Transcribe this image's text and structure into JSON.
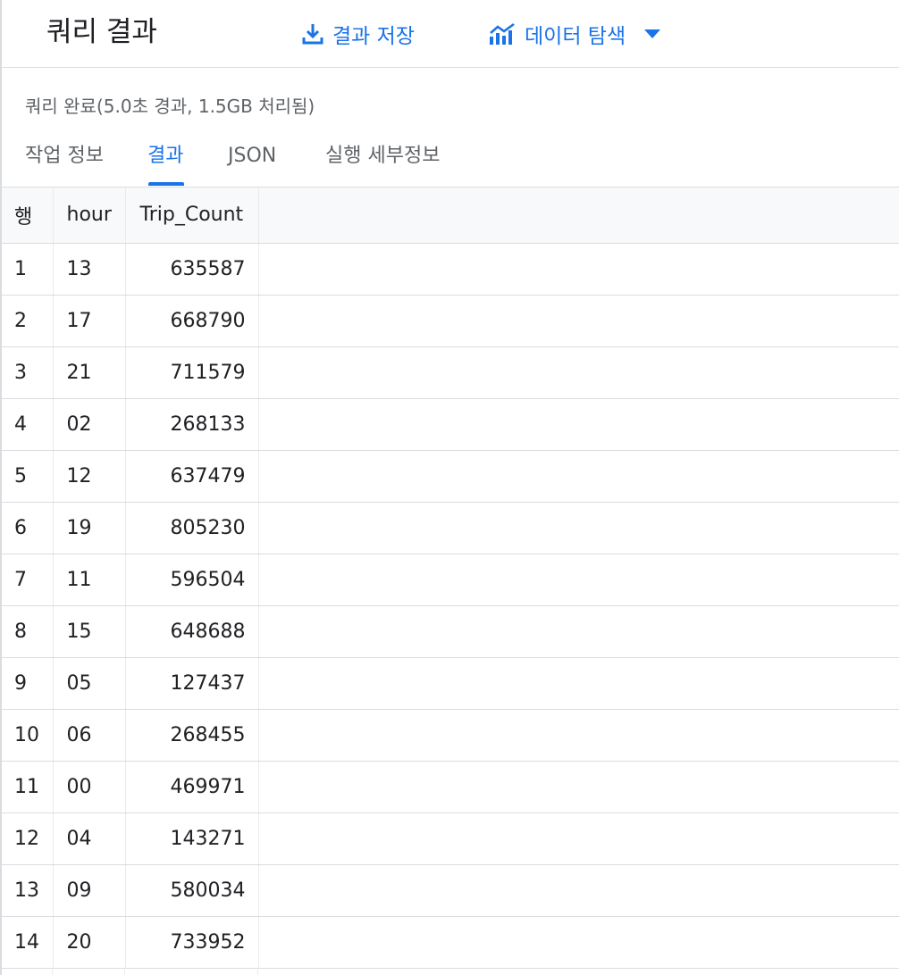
{
  "header": {
    "title": "쿼리 결과",
    "save_label": "결과 저장",
    "explore_label": "데이터 탐색",
    "accent_color": "#1a73e8",
    "icons": {
      "save": "download-icon",
      "explore": "chart-icon",
      "caret": "caret-down-icon"
    }
  },
  "status": "쿼리 완료(5.0초 경과, 1.5GB 처리됨)",
  "tabs": [
    {
      "label": "작업 정보",
      "active": false
    },
    {
      "label": "결과",
      "active": true
    },
    {
      "label": "JSON",
      "active": false
    },
    {
      "label": "실행 세부정보",
      "active": false
    }
  ],
  "table": {
    "columns": [
      "행",
      "hour",
      "Trip_Count"
    ],
    "rows": [
      [
        "1",
        "13",
        "635587"
      ],
      [
        "2",
        "17",
        "668790"
      ],
      [
        "3",
        "21",
        "711579"
      ],
      [
        "4",
        "02",
        "268133"
      ],
      [
        "5",
        "12",
        "637479"
      ],
      [
        "6",
        "19",
        "805230"
      ],
      [
        "7",
        "11",
        "596504"
      ],
      [
        "8",
        "15",
        "648688"
      ],
      [
        "9",
        "05",
        "127437"
      ],
      [
        "10",
        "06",
        "268455"
      ],
      [
        "11",
        "00",
        "469971"
      ],
      [
        "12",
        "04",
        "143271"
      ],
      [
        "13",
        "09",
        "580034"
      ],
      [
        "14",
        "20",
        "733952"
      ]
    ]
  }
}
